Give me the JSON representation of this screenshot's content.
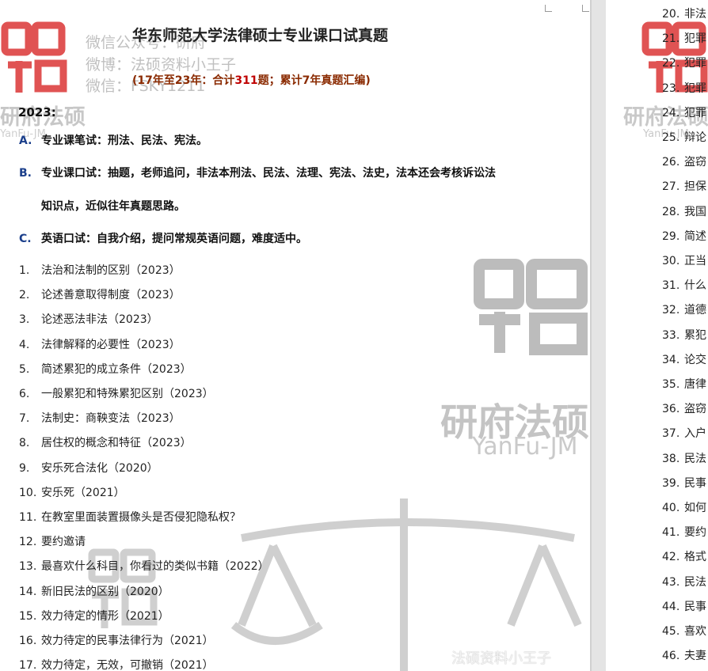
{
  "document": {
    "title": "华东师范大学法律硕士专业课口试真题",
    "subtitle_prefix": "(17年至23年：合计",
    "subtitle_count": "311",
    "subtitle_suffix": "题；累计7年真题汇编)",
    "year_heading": "2023:",
    "sections": [
      {
        "letter": "A.",
        "text": "专业课笔试：刑法、民法、宪法。"
      },
      {
        "letter": "B.",
        "text": "专业课口试：抽题，老师追问，非法本刑法、民法、法理、宪法、法史，法本还会考核诉讼法",
        "text2": "知识点，近似往年真题思路。"
      },
      {
        "letter": "C.",
        "text": "英语口试：自我介绍，提问常规英语问题，难度适中。"
      }
    ],
    "items": [
      {
        "num": "1.",
        "text": "法治和法制的区别（2023）"
      },
      {
        "num": "2.",
        "text": "论述善意取得制度（2023）"
      },
      {
        "num": "3.",
        "text": "论述恶法非法（2023）"
      },
      {
        "num": "4.",
        "text": "法律解释的必要性（2023）"
      },
      {
        "num": "5.",
        "text": "简述累犯的成立条件（2023）"
      },
      {
        "num": "6.",
        "text": "一般累犯和特殊累犯区别（2023）"
      },
      {
        "num": "7.",
        "text": "法制史：商鞅变法（2023）"
      },
      {
        "num": "8.",
        "text": "居住权的概念和特征（2023）"
      },
      {
        "num": "9.",
        "text": "安乐死合法化（2020）"
      },
      {
        "num": "10.",
        "text": "安乐死（2021）"
      },
      {
        "num": "11.",
        "text": "在教室里面装置摄像头是否侵犯隐私权？"
      },
      {
        "num": "12.",
        "text": "要约邀请"
      },
      {
        "num": "13.",
        "text": "最喜欢什么科目，你看过的类似书籍（2022）"
      },
      {
        "num": "14.",
        "text": "新旧民法的区别（2020）"
      },
      {
        "num": "15.",
        "text": "效力待定的情形（2021）"
      },
      {
        "num": "16.",
        "text": "效力待定的民事法律行为（2021）"
      },
      {
        "num": "17.",
        "text": "效力待定，无效，可撤销（2021）"
      }
    ]
  },
  "right_page_items": [
    {
      "num": "20.",
      "text": "非法"
    },
    {
      "num": "21.",
      "text": "犯罪"
    },
    {
      "num": "22.",
      "text": "犯罪"
    },
    {
      "num": "23.",
      "text": "犯罪"
    },
    {
      "num": "24.",
      "text": "犯罪"
    },
    {
      "num": "25.",
      "text": "辩论"
    },
    {
      "num": "26.",
      "text": "盗窃"
    },
    {
      "num": "27.",
      "text": "担保"
    },
    {
      "num": "28.",
      "text": "我国"
    },
    {
      "num": "29.",
      "text": "简述"
    },
    {
      "num": "30.",
      "text": "正当"
    },
    {
      "num": "31.",
      "text": "什么"
    },
    {
      "num": "32.",
      "text": "道德"
    },
    {
      "num": "33.",
      "text": "累犯"
    },
    {
      "num": "34.",
      "text": "论交"
    },
    {
      "num": "35.",
      "text": "唐律"
    },
    {
      "num": "36.",
      "text": "盗窃"
    },
    {
      "num": "37.",
      "text": "入户"
    },
    {
      "num": "38.",
      "text": "民法"
    },
    {
      "num": "39.",
      "text": "民事"
    },
    {
      "num": "40.",
      "text": "如何"
    },
    {
      "num": "41.",
      "text": "要约"
    },
    {
      "num": "42.",
      "text": "格式"
    },
    {
      "num": "43.",
      "text": "民法"
    },
    {
      "num": "44.",
      "text": "民事"
    },
    {
      "num": "45.",
      "text": "喜欢"
    },
    {
      "num": "46.",
      "text": "夫妻"
    }
  ],
  "watermarks": {
    "wechat_line": "微信公众号：研府",
    "weibo_line": "微博：法硕资料小王子",
    "wx_line": "微信：FSKY1211",
    "brand": "研府法硕",
    "brand_en": "YanFu-JM",
    "bottom": "法硕资料小王子"
  },
  "colors": {
    "accent_red": "#c00000",
    "subtitle_brown": "#8a2a00",
    "letter_blue": "#1b3f8b"
  }
}
